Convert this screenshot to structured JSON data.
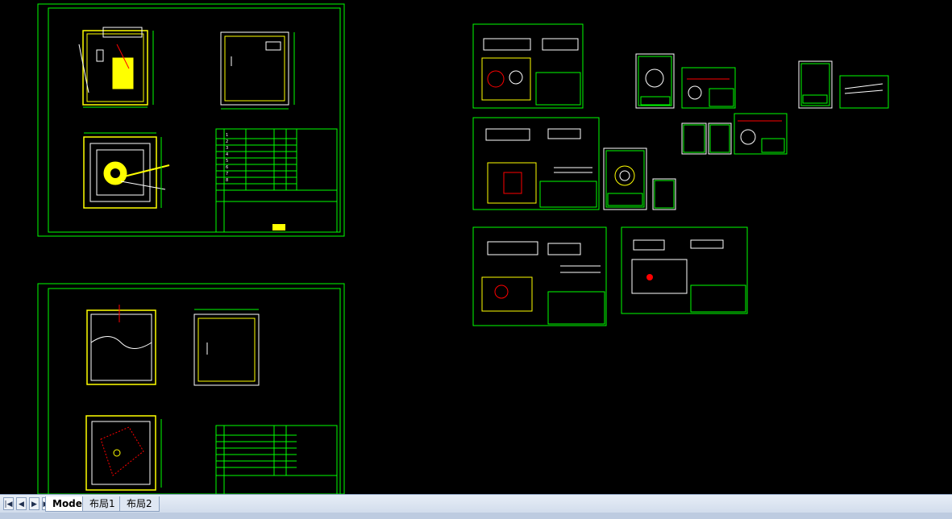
{
  "app": {
    "background": "#000000",
    "frame_color": "#00ff00",
    "line_color": "#ffffff",
    "accent_yellow": "#ffff00",
    "accent_red": "#ff0000"
  },
  "tabs": {
    "nav_icons": [
      "first-icon",
      "prev-icon",
      "next-icon",
      "last-icon"
    ],
    "items": [
      {
        "label": "Model",
        "active": true
      },
      {
        "label": "布局1",
        "active": false
      },
      {
        "label": "布局2",
        "active": false
      }
    ]
  },
  "drawing1": {
    "balloons": [
      "1",
      "2",
      "3",
      "4",
      "5",
      "6",
      "7",
      "8",
      "9",
      "10"
    ],
    "title_block": "TM"
  },
  "drawing2": {
    "balloons": [
      "1",
      "2",
      "3",
      "4",
      "5",
      "6",
      "7",
      "8"
    ]
  }
}
